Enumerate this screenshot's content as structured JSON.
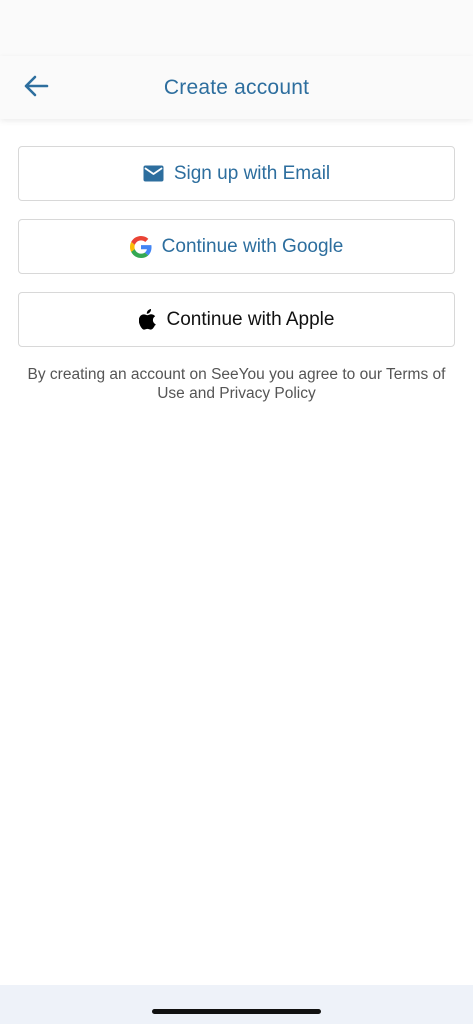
{
  "header": {
    "title": "Create account"
  },
  "auth_buttons": {
    "email_label": "Sign up with Email",
    "google_label": "Continue with Google",
    "apple_label": "Continue with Apple"
  },
  "legal": {
    "text": "By creating an account on SeeYou you agree to our Terms of Use and Privacy Policy"
  },
  "icons": {
    "back": "arrow-left-icon",
    "email": "envelope-icon",
    "google": "google-logo-icon",
    "apple": "apple-logo-icon"
  },
  "colors": {
    "accent": "#2d6e9e",
    "header_bg": "#fafafa",
    "border": "#d8d8d8",
    "bottom_bar_bg": "#eef2f9"
  }
}
